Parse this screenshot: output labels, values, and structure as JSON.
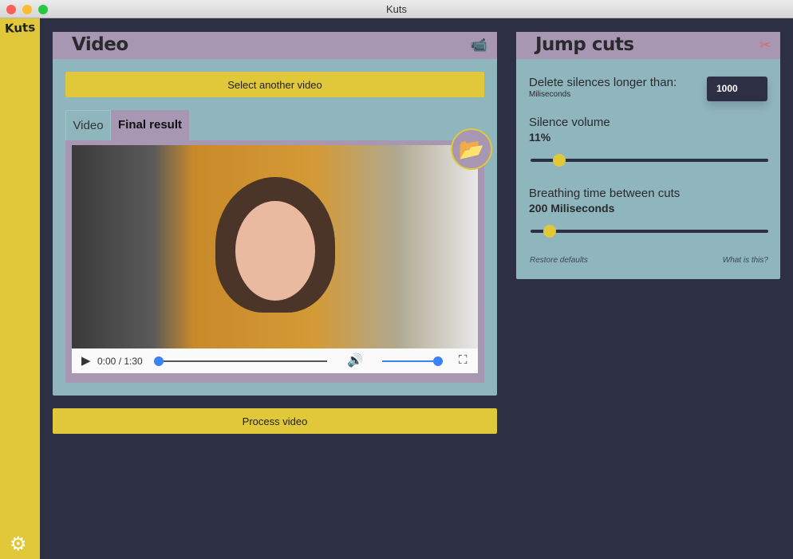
{
  "window": {
    "title": "Kuts"
  },
  "sidebar": {
    "logo": "Kuts",
    "settings_icon": "gear-icon"
  },
  "video_card": {
    "title": "Video",
    "icon": "video-camera-icon",
    "select_button": "Select another video",
    "tabs": [
      {
        "label": "Video",
        "active": false
      },
      {
        "label": "Final result",
        "active": true
      }
    ],
    "player": {
      "time": "0:00 / 1:30",
      "progress": 0,
      "volume": 1.0
    }
  },
  "process_button": "Process video",
  "jump_cuts": {
    "title": "Jump cuts",
    "icon": "scissors-icon",
    "delete_label": "Delete silences longer than:",
    "delete_unit": "Miliseconds",
    "delete_value": "1000",
    "silence_label": "Silence volume",
    "silence_value": "11%",
    "silence_fraction": 0.12,
    "breathing_label": "Breathing time between cuts",
    "breathing_value": "200 Miliseconds",
    "breathing_fraction": 0.08,
    "restore": "Restore defaults",
    "what": "What is this?"
  },
  "colors": {
    "yellow": "#e0c83a",
    "purple": "#a797b3",
    "teal": "#8fb5bd",
    "navy": "#2d2f45"
  }
}
